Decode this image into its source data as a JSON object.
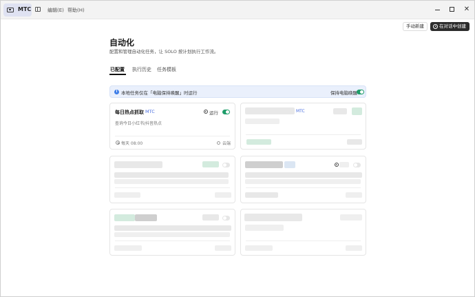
{
  "titlebar": {
    "tab_label": "MTC",
    "menu": [
      "编辑(E)",
      "帮助(H)"
    ],
    "controls": {
      "minimize": "—",
      "maximize": "□",
      "close": "✕"
    }
  },
  "actions": {
    "manual_create": "手动新建",
    "chat_create": "在对话中创建"
  },
  "page": {
    "title": "自动化",
    "subtitle": "配置和管理自动化任务，让 SOLO 按计划执行工作流。",
    "tabs": [
      "已配置",
      "执行历史",
      "任务模板"
    ],
    "active_tab": 0
  },
  "banner": {
    "text": "本地任务仅在「电脑保持唤醒」时运行",
    "keep_awake_label": "保持电脑唤醒",
    "keep_awake_on": true
  },
  "cards": [
    {
      "title": "每日热点抓取",
      "badge": "MTC",
      "run_label": "运行",
      "enabled": true,
      "description": "查询今日小红书/抖音热点",
      "schedule": "每天 08:00",
      "location": "云端"
    },
    {
      "badge": "MTC",
      "blurred": true
    },
    {
      "blurred": true
    },
    {
      "blurred": true
    },
    {
      "blurred": true
    },
    {
      "blurred": true
    }
  ],
  "colors": {
    "accent_green": "#1f9d6a",
    "badge_blue": "#4a6ee0",
    "banner_bg": "#eaf0fc",
    "primary_button": "#2c2c2c"
  }
}
